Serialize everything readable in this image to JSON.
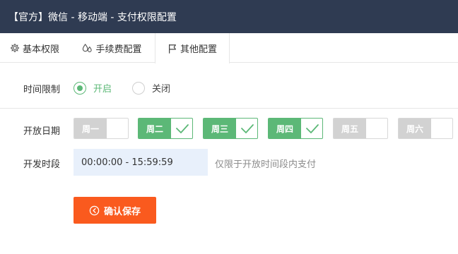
{
  "window": {
    "title": "【官方】微信 - 移动端 - 支付权限配置"
  },
  "tabs": [
    {
      "label": "基本权限",
      "icon": "gear-icon"
    },
    {
      "label": "手续费配置",
      "icon": "drops-icon"
    },
    {
      "label": "其他配置",
      "icon": "flag-icon",
      "active": true
    }
  ],
  "time_limit": {
    "label": "时间限制",
    "options": [
      {
        "label": "开启",
        "checked": true
      },
      {
        "label": "关闭",
        "checked": false
      }
    ]
  },
  "open_days": {
    "label": "开放日期",
    "days": [
      {
        "label": "周一",
        "selected": false
      },
      {
        "label": "周二",
        "selected": true
      },
      {
        "label": "周三",
        "selected": true
      },
      {
        "label": "周四",
        "selected": true
      },
      {
        "label": "周五",
        "selected": false
      },
      {
        "label": "周六",
        "selected": false
      }
    ]
  },
  "open_time": {
    "label": "开发时段",
    "value": "00:00:00 - 15:59:59",
    "hint": "仅限于开放时间段内支付"
  },
  "save_button": {
    "label": "确认保存",
    "icon": "circle-arrow-icon"
  },
  "colors": {
    "header_bg": "#2f3b52",
    "accent_green": "#5cb877",
    "save_orange": "#fa5a1e",
    "off_gray": "#d2d2d2"
  }
}
